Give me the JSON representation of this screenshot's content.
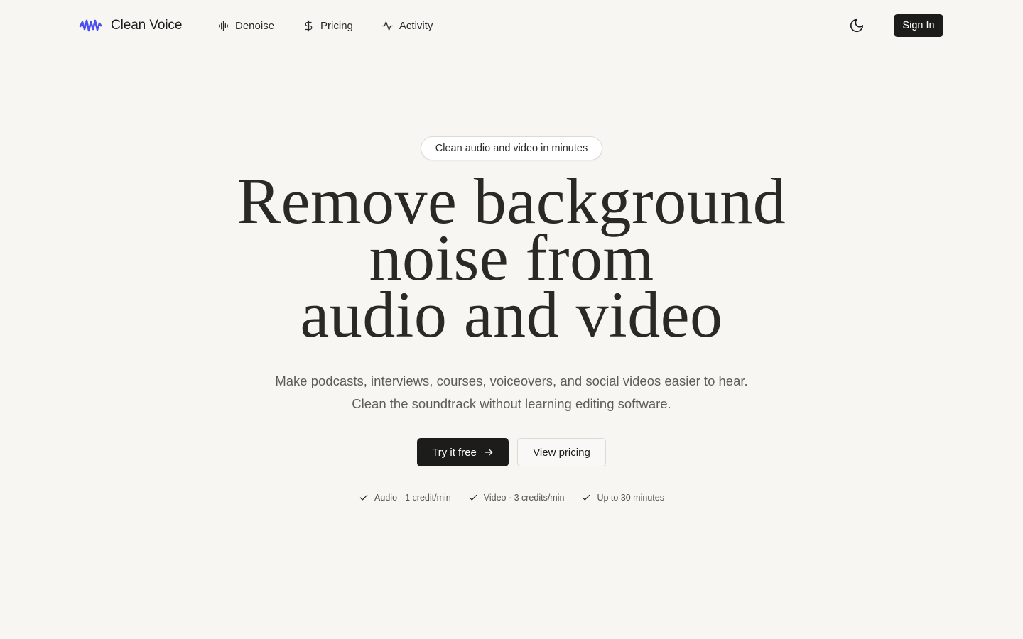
{
  "brand": {
    "name": "Clean Voice",
    "accent_color": "#4b4ff0",
    "icon": "waveform-logo-icon"
  },
  "nav": {
    "links": [
      {
        "label": "Denoise",
        "icon": "audio-lines-icon"
      },
      {
        "label": "Pricing",
        "icon": "dollar-sign-icon"
      },
      {
        "label": "Activity",
        "icon": "activity-icon"
      }
    ],
    "theme_toggle_icon": "moon-icon",
    "sign_in_label": "Sign In"
  },
  "hero": {
    "badge": "Clean audio and video in minutes",
    "headline_lines": [
      "Remove background",
      "noise from",
      "audio and video"
    ],
    "subtitle": "Make podcasts, interviews, courses, voiceovers, and social videos easier to hear. Clean the soundtrack without learning editing software.",
    "primary_cta": "Try it free",
    "primary_cta_icon": "arrow-right-icon",
    "secondary_cta": "View pricing",
    "features": [
      {
        "label": "Audio · 1 credit/min",
        "icon": "check-icon"
      },
      {
        "label": "Video · 3 credits/min",
        "icon": "check-icon"
      },
      {
        "label": "Up to 30 minutes",
        "icon": "check-icon"
      }
    ]
  }
}
